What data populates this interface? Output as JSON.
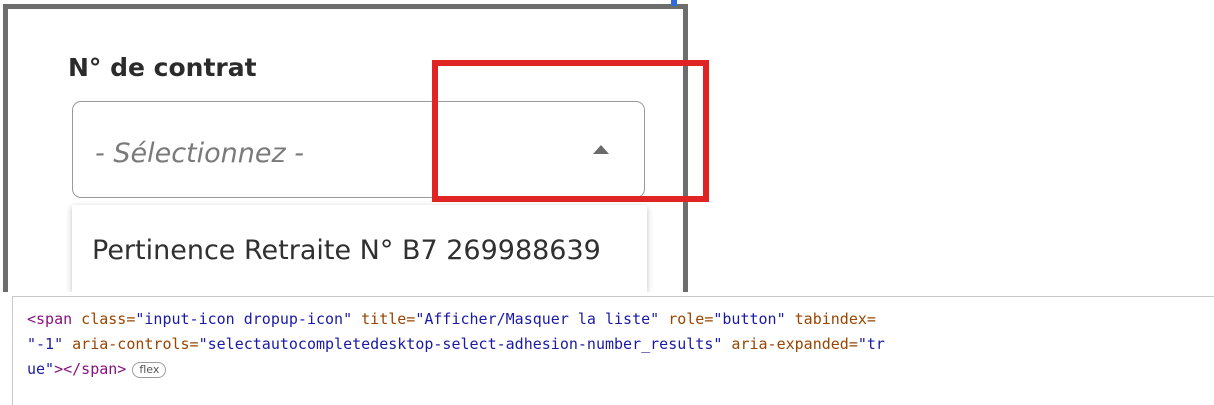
{
  "form": {
    "label": "N° de contrat",
    "placeholder": "- Sélectionnez -",
    "icon": "chevron-up-icon",
    "options": [
      "Pertinence Retraite N° B7 269988639"
    ]
  },
  "annotation": {
    "highlight_color": "#e02424"
  },
  "devtools": {
    "line1": {
      "open": "<span",
      "class_attr": " class=",
      "class_val": "\"input-icon dropup-icon\"",
      "title_attr": " title=",
      "title_val": "\"Afficher/Masquer la liste\"",
      "role_attr": " role=",
      "role_val": "\"button\"",
      "tabindex_attr": " tabindex="
    },
    "line2": {
      "tabindex_val": "\"-1\"",
      "controls_attr": " aria-controls=",
      "controls_val": "\"selectautocompletedesktop-select-adhesion-number_results\"",
      "expanded_attr": " aria-expanded=",
      "expanded_val_start": "\"tr"
    },
    "line3": {
      "expanded_val_end": "ue\"",
      "close": "></span>",
      "badge": "flex"
    }
  }
}
